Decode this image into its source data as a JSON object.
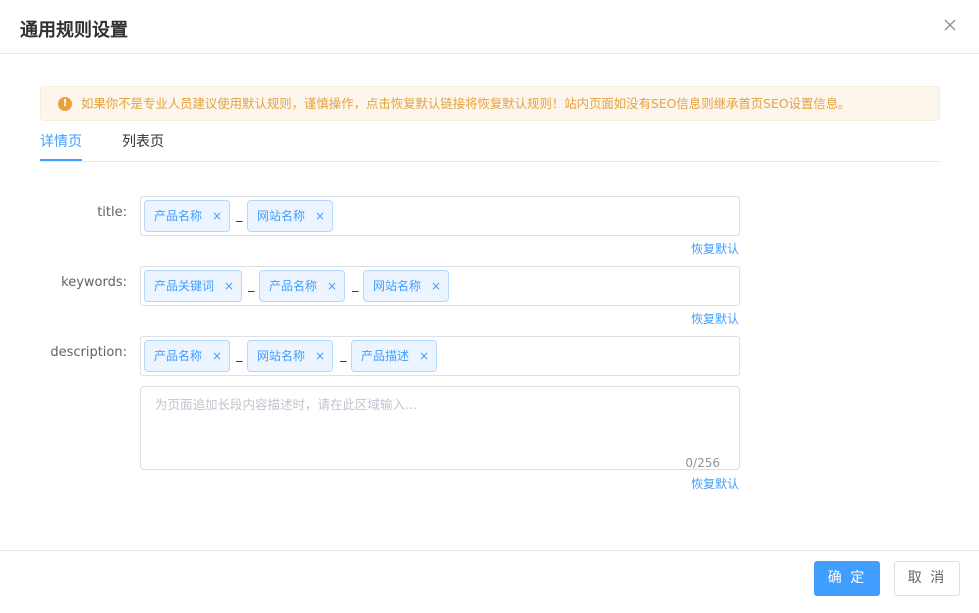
{
  "dialog": {
    "title": "通用规则设置",
    "close_icon": "close-icon"
  },
  "alert": {
    "icon": "warning-icon",
    "icon_glyph": "!",
    "text": "如果你不是专业人员建议使用默认规则，谨慎操作，点击恢复默认链接将恢复默认规则！站内页面如没有SEO信息则继承首页SEO设置信息。",
    "color": "#e6a23c"
  },
  "tabs": [
    {
      "label": "详情页",
      "active": true
    },
    {
      "label": "列表页",
      "active": false
    }
  ],
  "form": {
    "title": {
      "label": "title:",
      "tags": [
        "产品名称",
        "网站名称"
      ],
      "separators": [
        "_"
      ],
      "restore_label": "恢复默认"
    },
    "keywords": {
      "label": "keywords:",
      "tags": [
        "产品关键词",
        "产品名称",
        "网站名称"
      ],
      "separators": [
        "_",
        "_"
      ],
      "restore_label": "恢复默认"
    },
    "description": {
      "label": "description:",
      "tags": [
        "产品名称",
        "网站名称",
        "产品描述"
      ],
      "separators": [
        "_",
        "_"
      ],
      "textarea_placeholder": "为页面追加长段内容描述时，请在此区域输入...",
      "textarea_value": "",
      "word_count": "0/256",
      "restore_label": "恢复默认"
    }
  },
  "tag_close_glyph": "×",
  "footer": {
    "confirm_label": "确 定",
    "cancel_label": "取 消"
  },
  "colors": {
    "primary": "#409eff",
    "warning": "#e6a23c",
    "tag_bg": "#ecf5ff"
  }
}
